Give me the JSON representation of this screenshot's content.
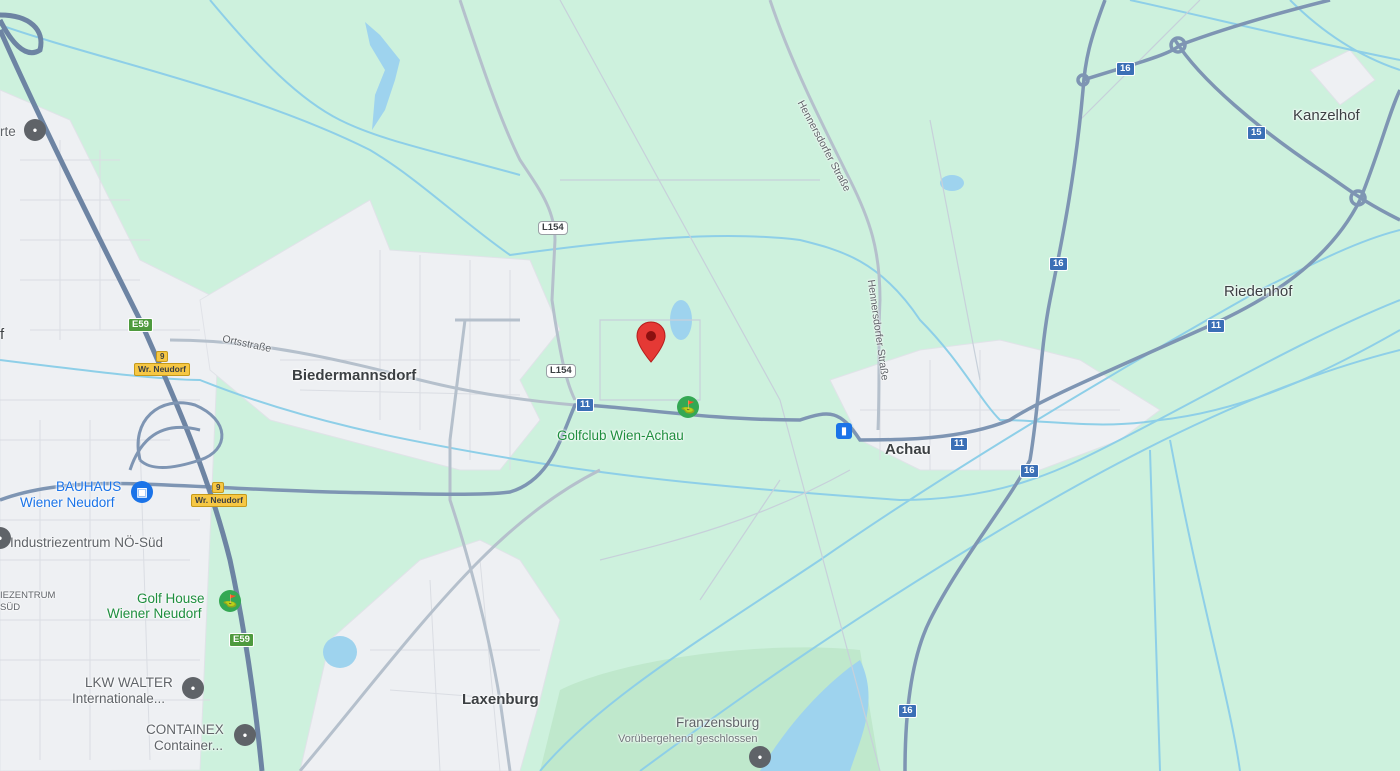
{
  "map": {
    "places": {
      "biedermannsdorf": "Biedermannsdorf",
      "achau": "Achau",
      "laxenburg": "Laxenburg",
      "kanzelhof": "Kanzelhof",
      "riedenhof": "Riedenhof"
    },
    "pois": {
      "golfclub": "Golfclub Wien-Achau",
      "bauhaus_line1": "BAUHAUS",
      "bauhaus_line2": "Wiener Neudorf",
      "industriezentrum": "Industriezentrum NÖ-Süd",
      "industriezentrum_partial_1": "IEZENTRUM",
      "industriezentrum_partial_2": "SÜD",
      "golfhouse_line1": "Golf House",
      "golfhouse_line2": "Wiener Neudorf",
      "lkw_line1": "LKW WALTER",
      "lkw_line2": "Internationale...",
      "containex_line1": "CONTAINEX",
      "containex_line2": "Container...",
      "franzensburg": "Franzensburg",
      "franzensburg_status": "Vorübergehend geschlossen",
      "left_edge_partial": "rte",
      "left_edge_f": "f"
    },
    "streets": {
      "ortsstrasse": "Ortsstraße",
      "hennersdorfer_1": "Hennersdorfer Straße",
      "hennersdorfer_2": "Hennersdorfer Straße"
    },
    "shields": {
      "l154_a": "L154",
      "l154_b": "L154",
      "r11_a": "11",
      "r11_b": "11",
      "r11_c": "11",
      "r16_a": "16",
      "r16_b": "16",
      "r16_c": "16",
      "r16_d": "16",
      "r15": "15",
      "e59_a": "E59",
      "e59_b": "E59",
      "exit9_a_num": "9",
      "exit9_a_name": "Wr. Neudorf",
      "exit9_b_num": "9",
      "exit9_b_name": "Wr. Neudorf"
    },
    "icons": {
      "selected": "location-pin-icon",
      "golf": "golf-flag-icon",
      "shop": "shopping-bag-icon",
      "transit": "train-station-icon"
    },
    "colors": {
      "park": "#cdf1dd",
      "urban": "#eef0f3",
      "water": "#9ed3ee",
      "stream": "#8ecfe8",
      "motorway": "#7e95b3",
      "road": "#b5c0cc",
      "selected_pin": "#e53935",
      "golf_pin": "#34a853",
      "shop_pin": "#1a73e8",
      "grey_pin": "#5f6368"
    }
  }
}
